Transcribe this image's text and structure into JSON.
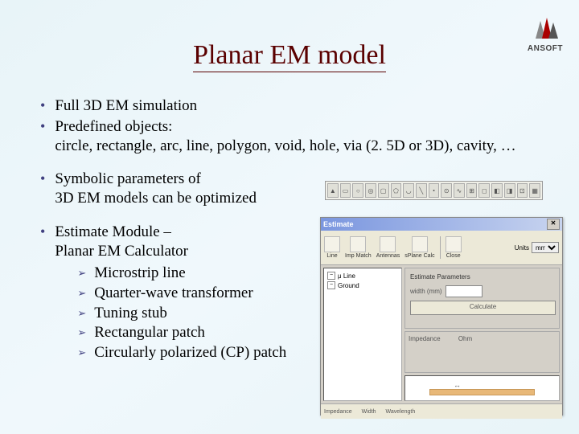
{
  "logo": {
    "brand": "ANSOFT"
  },
  "title": "Planar EM model",
  "bullets": [
    {
      "text": "Full 3D EM simulation"
    },
    {
      "text": "Predefined objects:",
      "cont": "circle, rectangle, arc, line, polygon, void, hole, via (2. 5D or 3D), cavity, …"
    },
    {
      "text": "Symbolic parameters of",
      "cont2": "3D EM models can be optimized"
    },
    {
      "text": "Estimate Module –",
      "cont2": "Planar EM Calculator",
      "subs": [
        "Microstrip line",
        "Quarter-wave transformer",
        "Tuning stub",
        "Rectangular patch",
        "Circularly polarized (CP) patch"
      ]
    }
  ],
  "estimate_window": {
    "title": "Estimate",
    "toolbar": {
      "items": [
        "Line",
        "Imp Match",
        "Antennas",
        "sPlane Calc",
        "Close"
      ],
      "units_label": "Units",
      "units_value": "mm"
    },
    "tree": {
      "items": [
        "μ Line",
        "Ground"
      ]
    },
    "params": {
      "group_label": "Estimate Parameters",
      "width_label": "width (mm)",
      "calc_button": "Calculate"
    },
    "result_label": "Impedance",
    "result_unit": "Ohm",
    "status": {
      "left": "Impedance",
      "mid": "Width",
      "right": "Wavelength"
    }
  }
}
